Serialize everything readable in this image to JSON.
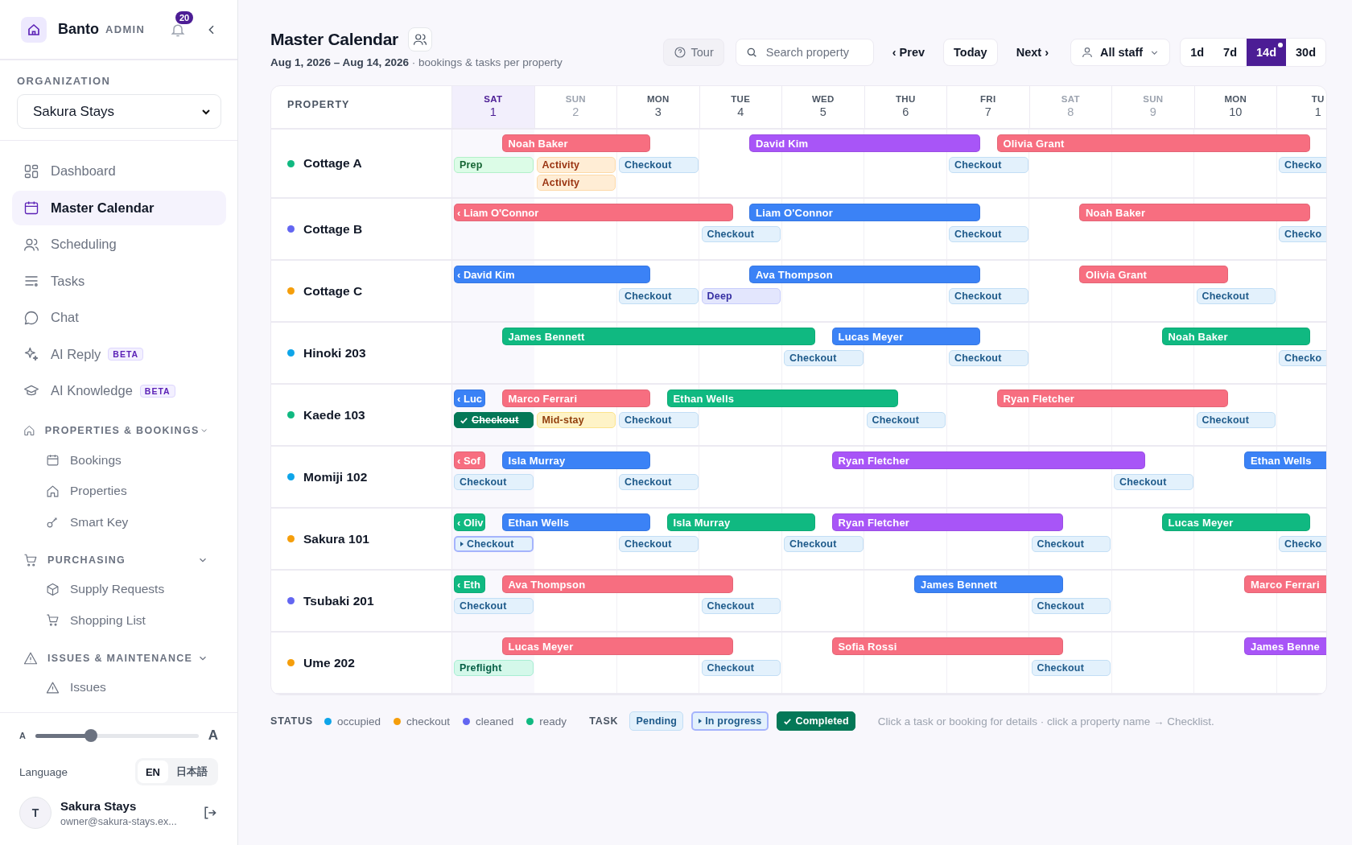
{
  "sidebar": {
    "brand": "Banto",
    "role": "ADMIN",
    "notifications": "20",
    "org_label": "ORGANIZATION",
    "org": "Sakura Stays",
    "nav": [
      {
        "kind": "link",
        "label": "Dashboard",
        "selected": false
      },
      {
        "kind": "link",
        "label": "Master Calendar",
        "selected": true
      },
      {
        "kind": "link",
        "label": "Scheduling",
        "selected": false
      },
      {
        "kind": "link",
        "label": "Tasks",
        "selected": false
      },
      {
        "kind": "link",
        "label": "Chat",
        "selected": false
      },
      {
        "kind": "link",
        "label": "AI Reply",
        "selected": false,
        "badge": "BETA"
      },
      {
        "kind": "link",
        "label": "AI Knowledge",
        "selected": false,
        "badge": "BETA"
      },
      {
        "kind": "section",
        "label": "PROPERTIES & BOOKINGS",
        "expanded": true
      },
      {
        "kind": "sublink",
        "label": "Bookings",
        "selected": false
      },
      {
        "kind": "sublink",
        "label": "Properties",
        "selected": false
      },
      {
        "kind": "sublink",
        "label": "Smart Key",
        "selected": false
      },
      {
        "kind": "section",
        "label": "PURCHASING",
        "expanded": true
      },
      {
        "kind": "sublink",
        "label": "Supply Requests",
        "selected": false
      },
      {
        "kind": "sublink",
        "label": "Shopping List",
        "selected": false
      },
      {
        "kind": "section",
        "label": "ISSUES & MAINTENANCE",
        "expanded": true
      },
      {
        "kind": "sublink",
        "label": "Issues",
        "selected": false
      }
    ],
    "text_size": {
      "small": "A",
      "large": "A",
      "level": 0.34
    },
    "language": {
      "label": "Language",
      "options": [
        {
          "label": "EN",
          "selected": true
        },
        {
          "label": "日本語",
          "selected": false
        }
      ]
    },
    "user": {
      "initial": "T",
      "name": "Sakura Stays",
      "email": "owner@sakura-stays.ex..."
    }
  },
  "header": {
    "title": "Master Calendar",
    "range": "Aug 1, 2026 – Aug 14, 2026",
    "subtitle": " · bookings & tasks per property",
    "tour": "Tour",
    "search": {
      "placeholder": "Search property"
    },
    "prev": "‹ Prev",
    "today": "Today",
    "next": "Next ›",
    "staff": "All staff",
    "spans": [
      {
        "label": "1d",
        "selected": false,
        "dot": false
      },
      {
        "label": "7d",
        "selected": false,
        "dot": false
      },
      {
        "label": "14d",
        "selected": true,
        "dot": true
      },
      {
        "label": "30d",
        "selected": false,
        "dot": false
      }
    ]
  },
  "calendar": {
    "column_title": "PROPERTY",
    "days": [
      {
        "weekday": "SAT",
        "date": "1",
        "today": true,
        "weekend": false
      },
      {
        "weekday": "SUN",
        "date": "2",
        "today": false,
        "weekend": true
      },
      {
        "weekday": "MON",
        "date": "3",
        "today": false,
        "weekend": false
      },
      {
        "weekday": "TUE",
        "date": "4",
        "today": false,
        "weekend": false
      },
      {
        "weekday": "WED",
        "date": "5",
        "today": false,
        "weekend": false
      },
      {
        "weekday": "THU",
        "date": "6",
        "today": false,
        "weekend": false
      },
      {
        "weekday": "FRI",
        "date": "7",
        "today": false,
        "weekend": false
      },
      {
        "weekday": "SAT",
        "date": "8",
        "today": false,
        "weekend": true
      },
      {
        "weekday": "SUN",
        "date": "9",
        "today": false,
        "weekend": true
      },
      {
        "weekday": "MON",
        "date": "10",
        "today": false,
        "weekend": false
      },
      {
        "weekday": "TU",
        "date": "1",
        "today": false,
        "weekend": false
      }
    ],
    "properties": [
      {
        "name": "Cottage A",
        "color": "#10b981",
        "bookings": [
          {
            "label": "Noah Baker",
            "color": "#f76e80"
          },
          {
            "label": "David Kim",
            "color": "#a855f7"
          },
          {
            "label": "Olivia Grant",
            "color": "#f76e80"
          }
        ],
        "tasks": [
          {
            "label": "Prep",
            "kind": "prep",
            "in_progress": false,
            "completed": false
          },
          {
            "label": "Activity",
            "kind": "activity",
            "in_progress": false,
            "completed": false
          },
          {
            "label": "Activity",
            "kind": "activity",
            "in_progress": false,
            "completed": false
          },
          {
            "label": "Checkout",
            "kind": "checkout",
            "in_progress": false,
            "completed": false
          },
          {
            "label": "Checkout",
            "kind": "checkout",
            "in_progress": false,
            "completed": false
          },
          {
            "label": "Checko",
            "kind": "checkout",
            "in_progress": false,
            "completed": false
          }
        ]
      },
      {
        "name": "Cottage B",
        "color": "#6366f1",
        "bookings": [
          {
            "label": "‹ Liam O'Connor",
            "color": "#f76e80"
          },
          {
            "label": "Liam O'Connor",
            "color": "#3b82f6"
          },
          {
            "label": "Noah Baker",
            "color": "#f76e80"
          }
        ],
        "tasks": [
          {
            "label": "Checkout",
            "kind": "checkout",
            "in_progress": false,
            "completed": false
          },
          {
            "label": "Checkout",
            "kind": "checkout",
            "in_progress": false,
            "completed": false
          },
          {
            "label": "Checko",
            "kind": "checkout",
            "in_progress": false,
            "completed": false
          }
        ]
      },
      {
        "name": "Cottage C",
        "color": "#f59e0b",
        "bookings": [
          {
            "label": "‹ David Kim",
            "color": "#3b82f6"
          },
          {
            "label": "Ava Thompson",
            "color": "#3b82f6"
          },
          {
            "label": "Olivia Grant",
            "color": "#f76e80"
          }
        ],
        "tasks": [
          {
            "label": "Checkout",
            "kind": "checkout",
            "in_progress": false,
            "completed": false
          },
          {
            "label": "Deep",
            "kind": "deep",
            "in_progress": false,
            "completed": false
          },
          {
            "label": "Checkout",
            "kind": "checkout",
            "in_progress": false,
            "completed": false
          },
          {
            "label": "Checkout",
            "kind": "checkout",
            "in_progress": false,
            "completed": false
          }
        ]
      },
      {
        "name": "Hinoki 203",
        "color": "#0ea5e9",
        "bookings": [
          {
            "label": "James Bennett",
            "color": "#10b981"
          },
          {
            "label": "Lucas Meyer",
            "color": "#3b82f6"
          },
          {
            "label": "Noah Baker",
            "color": "#10b981"
          }
        ],
        "tasks": [
          {
            "label": "Checkout",
            "kind": "checkout",
            "in_progress": false,
            "completed": false
          },
          {
            "label": "Checkout",
            "kind": "checkout",
            "in_progress": false,
            "completed": false
          },
          {
            "label": "Checko",
            "kind": "checkout",
            "in_progress": false,
            "completed": false
          }
        ]
      },
      {
        "name": "Kaede 103",
        "color": "#10b981",
        "bookings": [
          {
            "label": "‹ Luc",
            "color": "#3b82f6"
          },
          {
            "label": "Marco Ferrari",
            "color": "#f76e80"
          },
          {
            "label": "Ethan Wells",
            "color": "#10b981"
          },
          {
            "label": "Ryan Fletcher",
            "color": "#f76e80"
          }
        ],
        "tasks": [
          {
            "label": "Checkout",
            "kind": "checkout",
            "in_progress": false,
            "completed": true
          },
          {
            "label": "Mid-stay",
            "kind": "midstay",
            "in_progress": false,
            "completed": false
          },
          {
            "label": "Checkout",
            "kind": "checkout",
            "in_progress": false,
            "completed": false
          },
          {
            "label": "Checkout",
            "kind": "checkout",
            "in_progress": false,
            "completed": false
          },
          {
            "label": "Checkout",
            "kind": "checkout",
            "in_progress": false,
            "completed": false
          }
        ]
      },
      {
        "name": "Momiji 102",
        "color": "#0ea5e9",
        "bookings": [
          {
            "label": "‹ Sof",
            "color": "#f76e80"
          },
          {
            "label": "Isla Murray",
            "color": "#3b82f6"
          },
          {
            "label": "Ryan Fletcher",
            "color": "#a855f7"
          },
          {
            "label": "Ethan Wells",
            "color": "#3b82f6"
          }
        ],
        "tasks": [
          {
            "label": "Checkout",
            "kind": "checkout",
            "in_progress": false,
            "completed": false
          },
          {
            "label": "Checkout",
            "kind": "checkout",
            "in_progress": false,
            "completed": false
          },
          {
            "label": "Checkout",
            "kind": "checkout",
            "in_progress": false,
            "completed": false
          }
        ]
      },
      {
        "name": "Sakura 101",
        "color": "#f59e0b",
        "bookings": [
          {
            "label": "‹ Oliv",
            "color": "#10b981"
          },
          {
            "label": "Ethan Wells",
            "color": "#3b82f6"
          },
          {
            "label": "Isla Murray",
            "color": "#10b981"
          },
          {
            "label": "Ryan Fletcher",
            "color": "#a855f7"
          },
          {
            "label": "Lucas Meyer",
            "color": "#10b981"
          }
        ],
        "tasks": [
          {
            "label": "Checkout",
            "kind": "checkout",
            "in_progress": true,
            "completed": false
          },
          {
            "label": "Checkout",
            "kind": "checkout",
            "in_progress": false,
            "completed": false
          },
          {
            "label": "Checkout",
            "kind": "checkout",
            "in_progress": false,
            "completed": false
          },
          {
            "label": "Checkout",
            "kind": "checkout",
            "in_progress": false,
            "completed": false
          },
          {
            "label": "Checko",
            "kind": "checkout",
            "in_progress": false,
            "completed": false
          }
        ]
      },
      {
        "name": "Tsubaki 201",
        "color": "#6366f1",
        "bookings": [
          {
            "label": "‹ Eth",
            "color": "#10b981"
          },
          {
            "label": "Ava Thompson",
            "color": "#f76e80"
          },
          {
            "label": "James Bennett",
            "color": "#3b82f6"
          },
          {
            "label": "Marco Ferrari",
            "color": "#f76e80"
          }
        ],
        "tasks": [
          {
            "label": "Checkout",
            "kind": "checkout",
            "in_progress": false,
            "completed": false
          },
          {
            "label": "Checkout",
            "kind": "checkout",
            "in_progress": false,
            "completed": false
          },
          {
            "label": "Checkout",
            "kind": "checkout",
            "in_progress": false,
            "completed": false
          }
        ]
      },
      {
        "name": "Ume 202",
        "color": "#f59e0b",
        "bookings": [
          {
            "label": "Lucas Meyer",
            "color": "#f76e80"
          },
          {
            "label": "Sofia Rossi",
            "color": "#f76e80"
          },
          {
            "label": "James Benne",
            "color": "#a855f7"
          }
        ],
        "tasks": [
          {
            "label": "Preflight",
            "kind": "preflight",
            "in_progress": false,
            "completed": false
          },
          {
            "label": "Checkout",
            "kind": "checkout",
            "in_progress": false,
            "completed": false
          },
          {
            "label": "Checkout",
            "kind": "checkout",
            "in_progress": false,
            "completed": false
          }
        ]
      }
    ]
  },
  "legend": {
    "status_label": "STATUS",
    "statuses": [
      {
        "label": "occupied",
        "color": "#0ea5e9"
      },
      {
        "label": "checkout",
        "color": "#f59e0b"
      },
      {
        "label": "cleaned",
        "color": "#6366f1"
      },
      {
        "label": "ready",
        "color": "#10b981"
      }
    ],
    "task_label": "TASK",
    "tasks": [
      {
        "label": "Pending",
        "in_progress": false,
        "completed": false
      },
      {
        "label": "In progress",
        "in_progress": true,
        "completed": false
      },
      {
        "label": "Completed",
        "in_progress": false,
        "completed": true
      }
    ],
    "hint": "Click a task or booking for details · click a property name → Checklist."
  }
}
